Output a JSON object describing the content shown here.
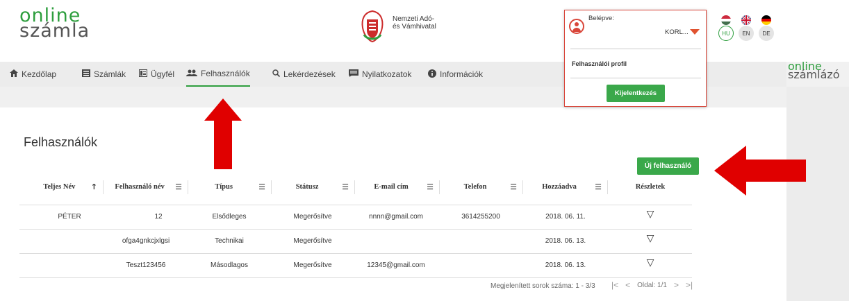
{
  "brand": {
    "line1": "online",
    "line2": "számla"
  },
  "nav_authority": {
    "line1": "Nemzeti Adó-",
    "line2": "és Vámhivatal"
  },
  "nav": [
    {
      "label": "Kezdőlap",
      "icon": "home-icon"
    },
    {
      "label": "Számlák",
      "icon": "invoice-icon"
    },
    {
      "label": "Ügyfél",
      "icon": "client-icon"
    },
    {
      "label": "Felhasználók",
      "icon": "users-icon"
    },
    {
      "label": "Lekérdezések",
      "icon": "search-icon"
    },
    {
      "label": "Nyilatkozatok",
      "icon": "statement-icon"
    },
    {
      "label": "Információk",
      "icon": "info-icon"
    }
  ],
  "right_logo": {
    "line1": "online",
    "line2": "számlázó"
  },
  "page": {
    "title": "Felhasználók",
    "new_user_label": "Új felhasználó"
  },
  "table": {
    "columns": [
      "Teljes Név",
      "Felhasználó név",
      "Típus",
      "Státusz",
      "E-mail cím",
      "Telefon",
      "Hozzáadva",
      "Részletek"
    ],
    "rows": [
      {
        "full_name": "PÉTER",
        "username": "12",
        "type": "Elsődleges",
        "status": "Megerősítve",
        "email": "nnnn@gmail.com",
        "phone": "3614255200",
        "added": "2018. 06. 11."
      },
      {
        "full_name": "",
        "username": "ofga4gnkcjxlgsi",
        "type": "Technikai",
        "status": "Megerősítve",
        "email": "",
        "phone": "",
        "added": "2018. 06. 13."
      },
      {
        "full_name": "",
        "username": "Teszt123456",
        "type": "Másodlagos",
        "status": "Megerősítve",
        "email": "12345@gmail.com",
        "phone": "",
        "added": "2018. 06. 13."
      }
    ]
  },
  "pager": {
    "rows_info": "Megjelenített sorok száma: 1 - 3/3",
    "page_info": "Oldal: 1/1"
  },
  "user_menu": {
    "logged_in_label": "Belépve:",
    "username": "KORL...",
    "profile_label": "Felhasználói profil",
    "logout_label": "Kijelentkezés"
  },
  "languages": [
    {
      "code": "HU",
      "active": true
    },
    {
      "code": "EN",
      "active": false
    },
    {
      "code": "DE",
      "active": false
    }
  ],
  "colors": {
    "accent": "#3aa84a",
    "alert": "#e00000",
    "popup_border": "#d9463a"
  }
}
